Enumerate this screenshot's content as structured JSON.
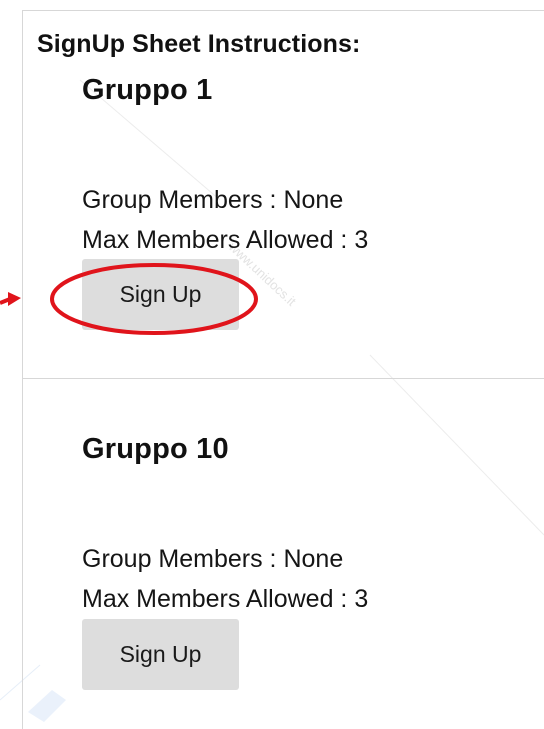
{
  "sheet": {
    "title": "SignUp Sheet Instructions:"
  },
  "groups": [
    {
      "name": "Gruppo 1",
      "members_label": "Group Members : None",
      "max_label": "Max Members Allowed : 3",
      "button_label": "Sign Up"
    },
    {
      "name": "Gruppo 10",
      "members_label": "Group Members : None",
      "max_label": "Max Members Allowed : 3",
      "button_label": "Sign Up"
    }
  ],
  "watermark": {
    "text": "www.unidocs.it"
  },
  "annotation": {
    "color": "#e0141b",
    "icons": [
      "arrow-icon",
      "highlight-ellipse-icon"
    ]
  },
  "colors": {
    "button_bg": "#dddddd",
    "divider": "#d7d7d7"
  }
}
